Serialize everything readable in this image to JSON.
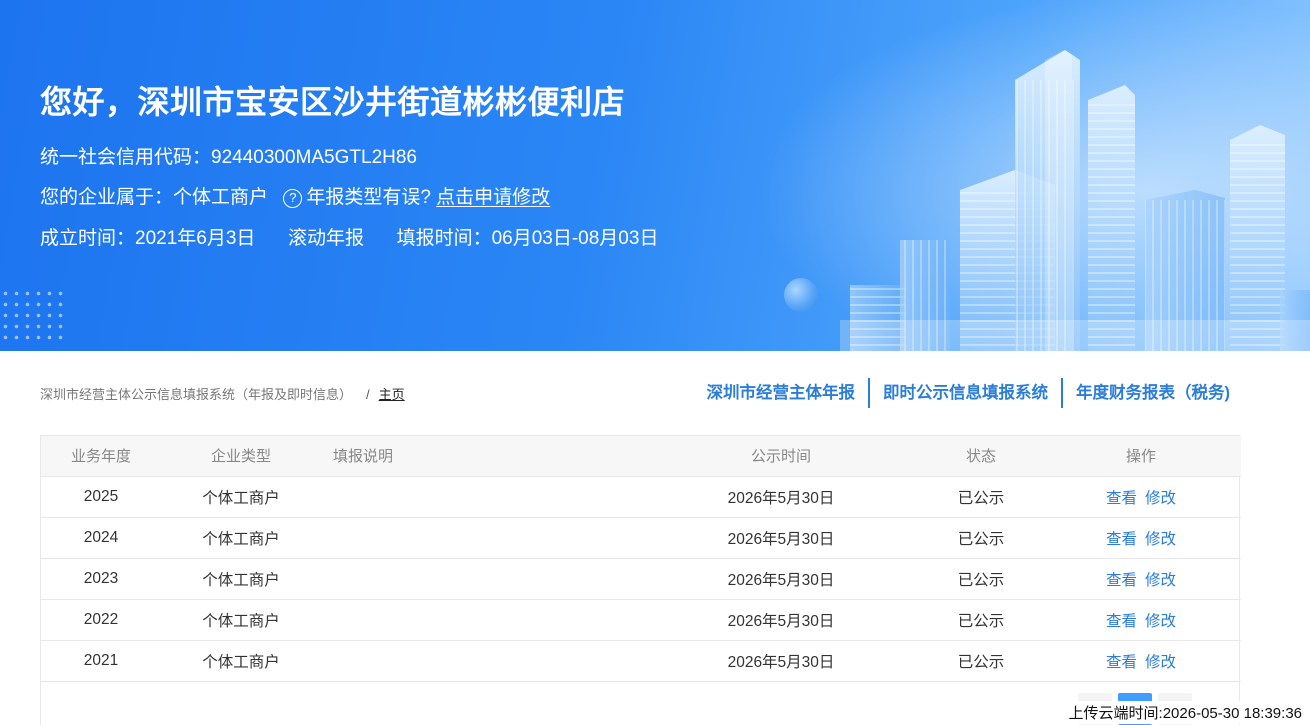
{
  "banner": {
    "greeting": "您好，深圳市宝安区沙井街道彬彬便利店",
    "credit_code_label": "统一社会信用代码：",
    "credit_code": "92440300MA5GTL2H86",
    "enterprise_type_label": "您的企业属于：",
    "enterprise_type": "个体工商户",
    "report_type_question": "年报类型有误?",
    "apply_link": "点击申请修改",
    "established_label": "成立时间：",
    "established_date": "2021年6月3日",
    "report_mode": "滚动年报",
    "fill_period_label": "填报时间：",
    "fill_period": "06月03日-08月03日"
  },
  "breadcrumb": {
    "system": "深圳市经营主体公示信息填报系统（年报及即时信息）",
    "separator": "/",
    "home": "主页"
  },
  "system_links": [
    "深圳市经营主体年报",
    "即时公示信息填报系统",
    "年度财务报表（税务)"
  ],
  "table": {
    "headers": {
      "year": "业务年度",
      "type": "企业类型",
      "desc": "填报说明",
      "published": "公示时间",
      "status": "状态",
      "ops": "操作"
    },
    "rows": [
      {
        "year": "2025",
        "type": "个体工商户",
        "desc": "",
        "published": "2026年5月30日",
        "status": "已公示",
        "view": "查看",
        "edit": "修改"
      },
      {
        "year": "2024",
        "type": "个体工商户",
        "desc": "",
        "published": "2026年5月30日",
        "status": "已公示",
        "view": "查看",
        "edit": "修改"
      },
      {
        "year": "2023",
        "type": "个体工商户",
        "desc": "",
        "published": "2026年5月30日",
        "status": "已公示",
        "view": "查看",
        "edit": "修改"
      },
      {
        "year": "2022",
        "type": "个体工商户",
        "desc": "",
        "published": "2026年5月30日",
        "status": "已公示",
        "view": "查看",
        "edit": "修改"
      },
      {
        "year": "2021",
        "type": "个体工商户",
        "desc": "",
        "published": "2026年5月30日",
        "status": "已公示",
        "view": "查看",
        "edit": "修改"
      }
    ]
  },
  "upload_stamp": "上传云端时间:2026-05-30 18:39:36",
  "colors": {
    "banner_blue": "#1d74ef",
    "link_blue": "#2b7ddb",
    "pager_active": "#409eff"
  }
}
